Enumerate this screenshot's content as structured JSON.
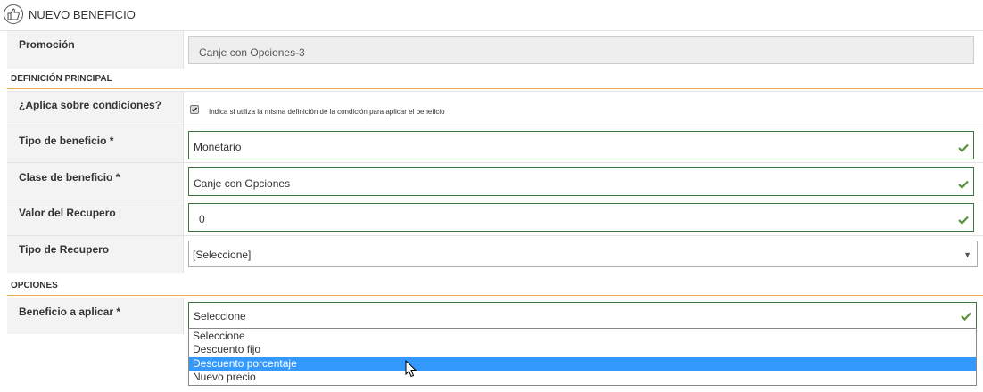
{
  "header": {
    "title": "NUEVO BENEFICIO",
    "icon": "thumbs-up-icon"
  },
  "promocion": {
    "label": "Promoción",
    "value": "Canje con Opciones-3"
  },
  "sections": {
    "principal": "DEFINICIÓN PRINCIPAL",
    "opciones": "OPCIONES"
  },
  "aplica": {
    "label": "¿Aplica sobre condiciones?",
    "checked": true,
    "help": "Indica si utiliza la misma definición de la condición para aplicar el beneficio"
  },
  "tipo_beneficio": {
    "label": "Tipo de beneficio *",
    "value": "Monetario"
  },
  "clase_beneficio": {
    "label": "Clase de beneficio *",
    "value": "Canje con Opciones"
  },
  "valor_recupero": {
    "label": "Valor del Recupero",
    "value": "0"
  },
  "tipo_recupero": {
    "label": "Tipo de Recupero",
    "value": "[Seleccione]"
  },
  "beneficio_aplicar": {
    "label": "Beneficio a aplicar *",
    "value": "Seleccione",
    "options": [
      "Seleccione",
      "Descuento fijo",
      "Descuento porcentaje",
      "Nuevo precio"
    ],
    "highlighted": "Descuento porcentaje"
  },
  "colors": {
    "valid_border": "#3c763d",
    "check": "#5a8f3c",
    "section_line": "#f0ad4e",
    "highlight": "#3399ff"
  }
}
